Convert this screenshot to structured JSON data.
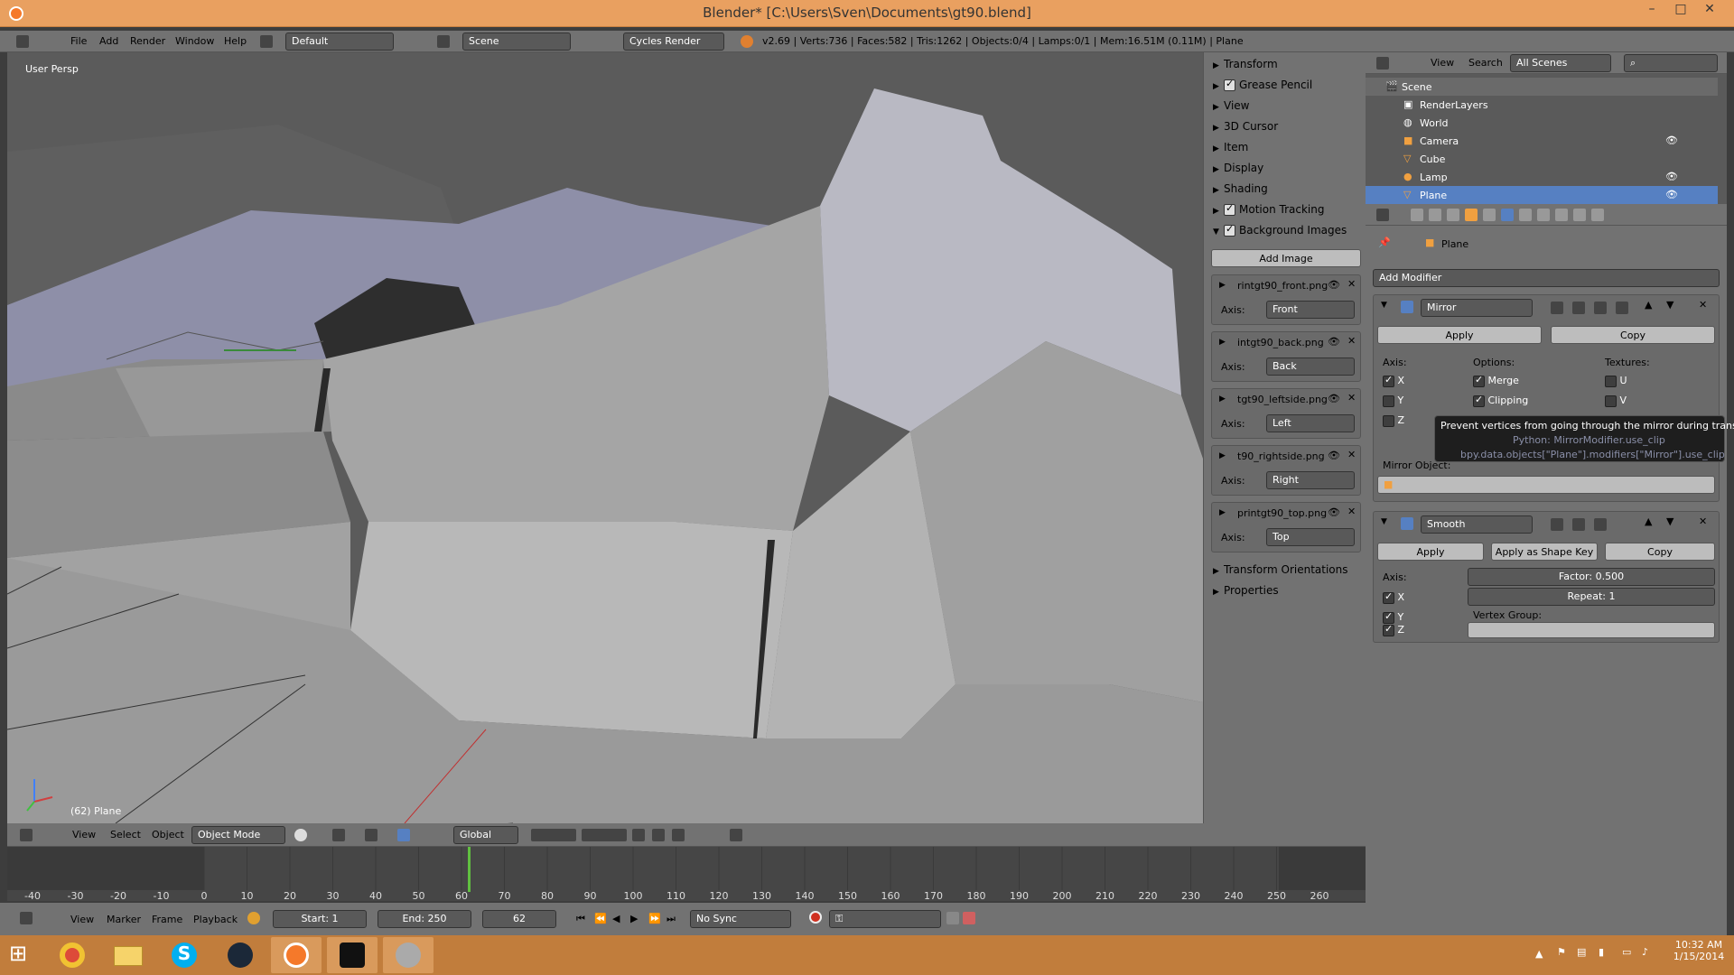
{
  "titlebar": {
    "title": "Blender* [C:\\Users\\Sven\\Documents\\gt90.blend]",
    "minimize": "–",
    "maximize": "□",
    "close": "✕"
  },
  "infobar": {
    "menus": [
      "File",
      "Add",
      "Render",
      "Window",
      "Help"
    ],
    "layout": "Default",
    "scene": "Scene",
    "engine": "Cycles Render",
    "stats": "v2.69 | Verts:736 | Faces:582 | Tris:1262 | Objects:0/4 | Lamps:0/1 | Mem:16.51M (0.11M) | Plane"
  },
  "viewport": {
    "label": "User Persp",
    "object_label": "(62) Plane"
  },
  "npanel": {
    "sections": [
      {
        "label": "Transform",
        "checkbox": false
      },
      {
        "label": "Grease Pencil",
        "checkbox": true
      },
      {
        "label": "View",
        "checkbox": false
      },
      {
        "label": "3D Cursor",
        "checkbox": false
      },
      {
        "label": "Item",
        "checkbox": false
      },
      {
        "label": "Display",
        "checkbox": false
      },
      {
        "label": "Shading",
        "checkbox": false
      },
      {
        "label": "Motion Tracking",
        "checkbox": true
      },
      {
        "label": "Background Images",
        "checkbox": true
      }
    ],
    "add_image": "Add Image",
    "axis_label": "Axis:",
    "images": [
      {
        "file": "rintgt90_front.png",
        "axis": "Front"
      },
      {
        "file": "intgt90_back.png",
        "axis": "Back"
      },
      {
        "file": "tgt90_leftside.png",
        "axis": "Left"
      },
      {
        "file": "t90_rightside.png",
        "axis": "Right"
      },
      {
        "file": "printgt90_top.png",
        "axis": "Top"
      }
    ],
    "transform_orientations": "Transform Orientations",
    "properties": "Properties"
  },
  "outliner": {
    "view": "View",
    "search": "Search",
    "filter": "All Scenes",
    "items": [
      "Scene",
      "RenderLayers",
      "World",
      "Camera",
      "Cube",
      "Lamp",
      "Plane"
    ]
  },
  "properties": {
    "context_object": "Plane",
    "add_modifier": "Add Modifier",
    "mirror": {
      "name": "Mirror",
      "apply": "Apply",
      "copy": "Copy",
      "axis": "Axis:",
      "options": "Options:",
      "textures": "Textures:",
      "x": "X",
      "y": "Y",
      "z": "Z",
      "merge": "Merge",
      "clipping": "Clipping",
      "u": "U",
      "v": "V",
      "mirror_object": "Mirror Object:"
    },
    "smooth": {
      "name": "Smooth",
      "apply": "Apply",
      "apply_shape": "Apply as Shape Key",
      "copy": "Copy",
      "axis": "Axis:",
      "x": "X",
      "y": "Y",
      "z": "Z",
      "factor": "Factor: 0.500",
      "repeat": "Repeat: 1",
      "vertex_group": "Vertex Group:"
    },
    "tooltip": {
      "line1": "Prevent vertices from going through the mirror during transform",
      "line2": "Python: MirrorModifier.use_clip",
      "line3": "bpy.data.objects[\"Plane\"].modifiers[\"Mirror\"].use_clip"
    }
  },
  "view3d_header": {
    "view": "View",
    "select": "Select",
    "object": "Object",
    "mode": "Object Mode",
    "orientation": "Global"
  },
  "timeline": {
    "ticks": [
      "-40",
      "-30",
      "-20",
      "-10",
      "0",
      "10",
      "20",
      "30",
      "40",
      "50",
      "60",
      "70",
      "80",
      "90",
      "100",
      "110",
      "120",
      "130",
      "140",
      "150",
      "160",
      "170",
      "180",
      "190",
      "200",
      "210",
      "220",
      "230",
      "240",
      "250",
      "260"
    ],
    "current_frame": 62,
    "view": "View",
    "marker": "Marker",
    "frame": "Frame",
    "playback": "Playback",
    "start": "Start: 1",
    "end": "End: 250",
    "frame_field": "62",
    "sync": "No Sync"
  },
  "taskbar": {
    "time": "10:32 AM",
    "date": "1/15/2014"
  },
  "colors": {
    "titlebar": "#e9a060",
    "panel": "#727272",
    "viewport": "#5a5a5a",
    "taskbar": "#c17d3c",
    "selection": "#5680c2"
  }
}
